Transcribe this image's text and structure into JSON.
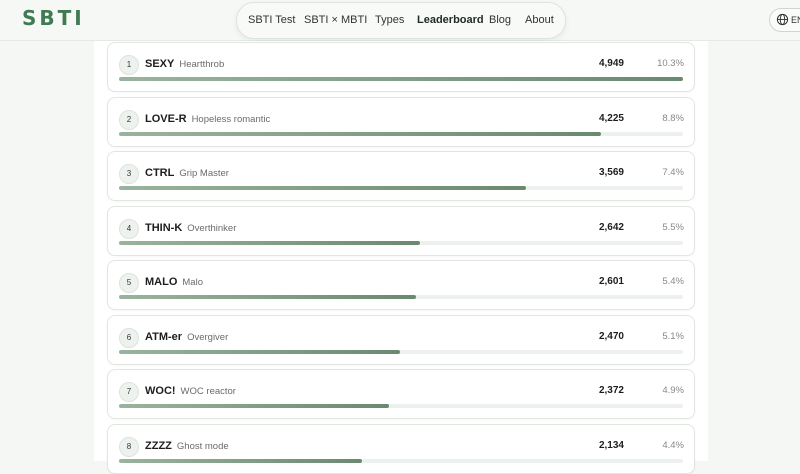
{
  "header": {
    "logo": "SBTI",
    "nav": [
      {
        "label": "SBTI Test"
      },
      {
        "label": "SBTI × MBTI"
      },
      {
        "label": "Types"
      },
      {
        "label": "Leaderboard"
      },
      {
        "label": "Blog"
      },
      {
        "label": "About"
      }
    ],
    "active_nav": "Leaderboard",
    "language": "EN"
  },
  "colors": {
    "brand": "#3f7a52",
    "bar": "#6a8a70",
    "track": "#edf1ed"
  },
  "leaderboard": [
    {
      "rank": "1",
      "code": "SEXY",
      "name": "Heartthrob",
      "count": "4,949",
      "percent": "10.3%",
      "bar_fraction": 1.0
    },
    {
      "rank": "2",
      "code": "LOVE-R",
      "name": "Hopeless romantic",
      "count": "4,225",
      "percent": "8.8%",
      "bar_fraction": 0.855
    },
    {
      "rank": "3",
      "code": "CTRL",
      "name": "Grip Master",
      "count": "3,569",
      "percent": "7.4%",
      "bar_fraction": 0.722
    },
    {
      "rank": "4",
      "code": "THIN-K",
      "name": "Overthinker",
      "count": "2,642",
      "percent": "5.5%",
      "bar_fraction": 0.534
    },
    {
      "rank": "5",
      "code": "MALO",
      "name": "Malo",
      "count": "2,601",
      "percent": "5.4%",
      "bar_fraction": 0.526
    },
    {
      "rank": "6",
      "code": "ATM-er",
      "name": "Overgiver",
      "count": "2,470",
      "percent": "5.1%",
      "bar_fraction": 0.499
    },
    {
      "rank": "7",
      "code": "WOC!",
      "name": "WOC reactor",
      "count": "2,372",
      "percent": "4.9%",
      "bar_fraction": 0.479
    },
    {
      "rank": "8",
      "code": "ZZZZ",
      "name": "Ghost mode",
      "count": "2,134",
      "percent": "4.4%",
      "bar_fraction": 0.431
    }
  ]
}
